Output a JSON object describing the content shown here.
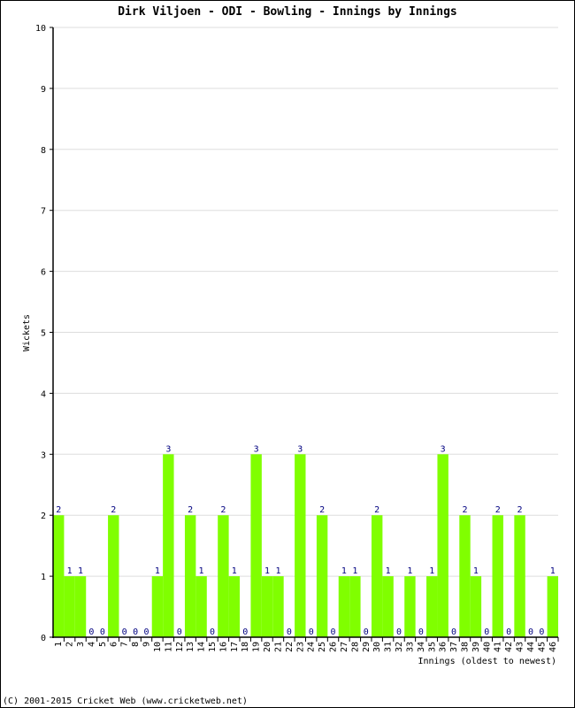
{
  "chart_data": {
    "type": "bar",
    "title": "Dirk Viljoen - ODI - Bowling - Innings by Innings",
    "xlabel": "Innings (oldest to newest)",
    "ylabel": "Wickets",
    "ylim": [
      0,
      10
    ],
    "yticks": [
      "0",
      "1",
      "2",
      "3",
      "4",
      "5",
      "6",
      "7",
      "8",
      "9",
      "10"
    ],
    "grid": true,
    "categories": [
      "1",
      "2",
      "3",
      "4",
      "5",
      "6",
      "7",
      "8",
      "9",
      "10",
      "11",
      "12",
      "13",
      "14",
      "15",
      "16",
      "17",
      "18",
      "19",
      "20",
      "21",
      "22",
      "23",
      "24",
      "25",
      "26",
      "27",
      "28",
      "29",
      "30",
      "31",
      "32",
      "33",
      "34",
      "35",
      "36",
      "37",
      "38",
      "39",
      "40",
      "41",
      "42",
      "43",
      "44",
      "45",
      "46"
    ],
    "values": [
      2,
      1,
      1,
      0,
      0,
      2,
      0,
      0,
      0,
      1,
      3,
      0,
      2,
      1,
      0,
      2,
      1,
      0,
      3,
      1,
      1,
      0,
      3,
      0,
      2,
      0,
      1,
      1,
      0,
      2,
      1,
      0,
      1,
      0,
      1,
      3,
      0,
      2,
      1,
      0,
      2,
      0,
      2,
      0,
      0,
      1
    ],
    "colors": {
      "bar": "#80ff00",
      "label": "#000080",
      "grid": "#dddddd",
      "axis": "#000000"
    }
  },
  "footer": "(C) 2001-2015 Cricket Web (www.cricketweb.net)"
}
